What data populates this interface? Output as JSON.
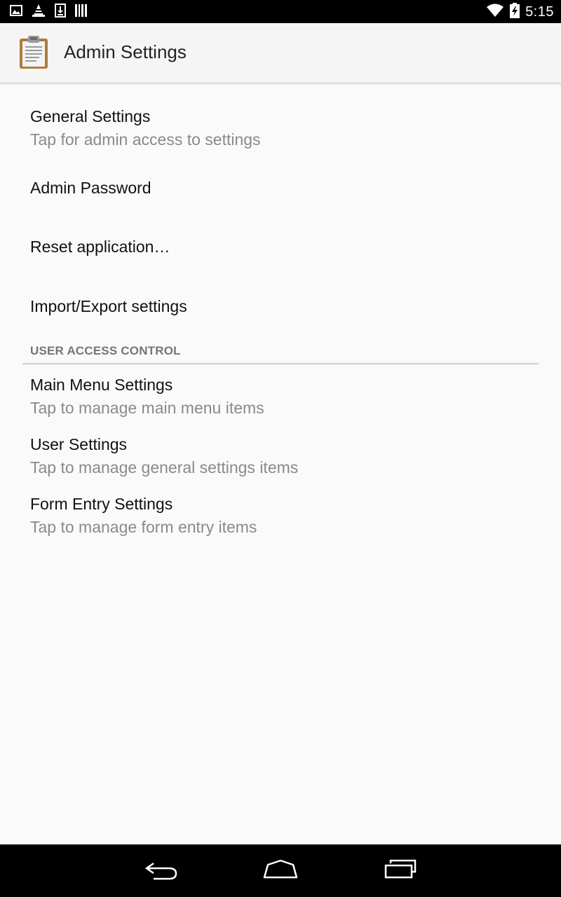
{
  "status_bar": {
    "time": "5:15",
    "notification_icons": [
      "image-icon",
      "vlc-cone-icon",
      "download-icon",
      "barcode-icon"
    ],
    "system_icons": [
      "wifi-icon",
      "battery-charging-icon"
    ]
  },
  "action_bar": {
    "icon": "clipboard-icon",
    "title": "Admin Settings"
  },
  "preferences": {
    "general": {
      "title": "General Settings",
      "summary": "Tap for admin access to settings"
    },
    "admin_password": {
      "title": "Admin Password"
    },
    "reset": {
      "title": "Reset application…"
    },
    "import_export": {
      "title": "Import/Export settings"
    }
  },
  "user_access_control": {
    "header": "USER ACCESS CONTROL",
    "main_menu": {
      "title": "Main Menu Settings",
      "summary": "Tap to manage main menu items"
    },
    "user_settings": {
      "title": "User Settings",
      "summary": "Tap to manage general settings items"
    },
    "form_entry": {
      "title": "Form Entry Settings",
      "summary": "Tap to manage form entry items"
    }
  },
  "nav_bar": {
    "buttons": [
      "back-icon",
      "home-icon",
      "recents-icon"
    ]
  },
  "colors": {
    "background": "#fafafa",
    "action_bar": "#f5f5f5",
    "title_text": "#111111",
    "summary_text": "#8a8a8a",
    "category_text": "#757575",
    "divider": "#cfcfcf",
    "system_bars": "#000000"
  }
}
